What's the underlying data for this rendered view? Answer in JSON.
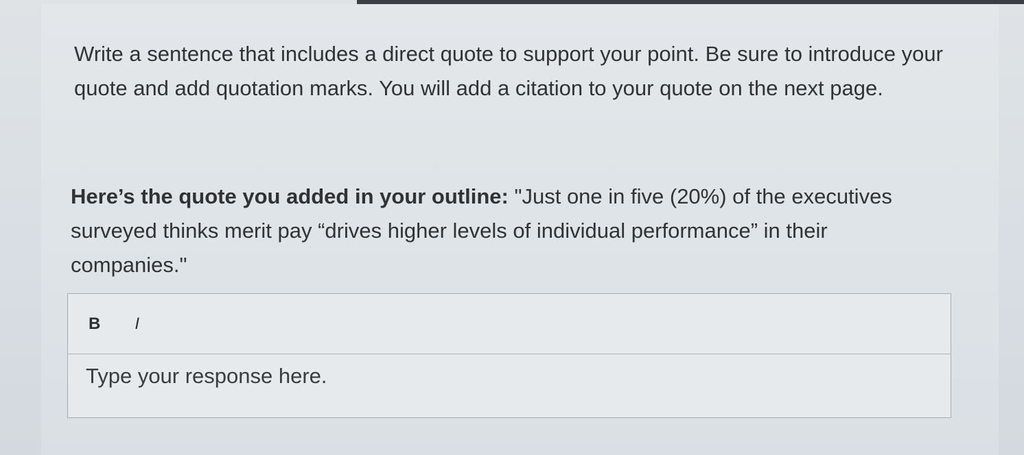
{
  "question": {
    "instructions": "Write a sentence that includes a direct quote to support your point. Be sure to introduce your quote and add quotation marks. You will add a citation to your quote on the next page.",
    "quote_lead": "Here’s the quote you added in your outline:",
    "quote_text": " \"Just one in five (20%) of the executives surveyed thinks merit pay “drives higher levels of individual performance” in their companies.\""
  },
  "editor": {
    "bold_label": "B",
    "italic_label": "I",
    "placeholder": "Type your response here.",
    "value": ""
  }
}
